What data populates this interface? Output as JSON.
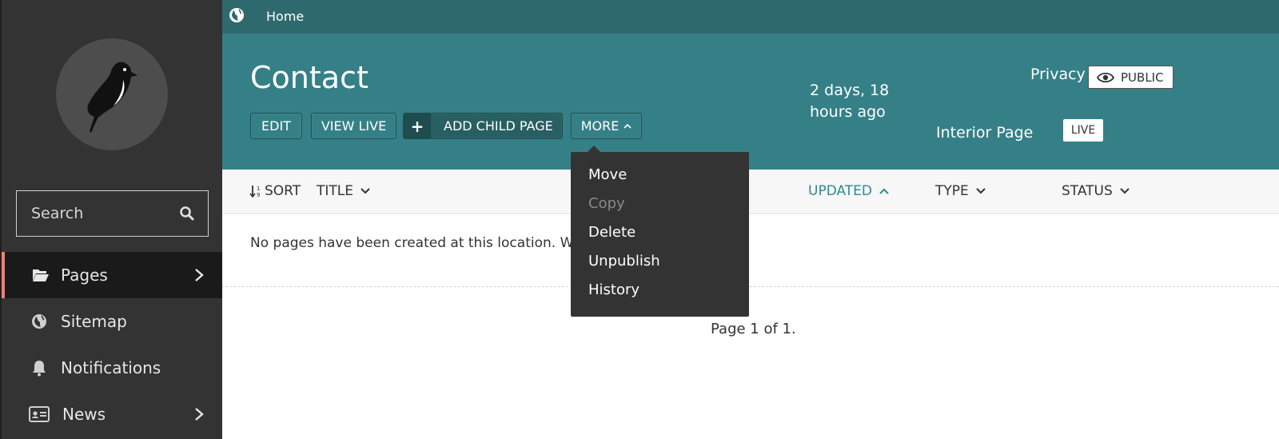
{
  "sidebar": {
    "search_label": "Search",
    "items": [
      {
        "label": "Pages",
        "icon": "folder-open-icon",
        "active": true,
        "has_submenu": true
      },
      {
        "label": "Sitemap",
        "icon": "globe-icon",
        "active": false,
        "has_submenu": false
      },
      {
        "label": "Notifications",
        "icon": "bell-icon",
        "active": false,
        "has_submenu": false
      },
      {
        "label": "News",
        "icon": "id-card-icon",
        "active": false,
        "has_submenu": true
      }
    ]
  },
  "breadcrumb": {
    "items": [
      "Home"
    ]
  },
  "header": {
    "title": "Contact",
    "buttons": {
      "edit": "EDIT",
      "view_live": "VIEW LIVE",
      "add_child": "ADD CHILD PAGE",
      "more": "MORE"
    },
    "updated": "2 days, 18 hours ago",
    "type": "Interior Page",
    "status": "LIVE",
    "privacy_label": "Privacy",
    "privacy_value": "PUBLIC"
  },
  "dropdown": {
    "items": [
      {
        "label": "Move",
        "disabled": false
      },
      {
        "label": "Copy",
        "disabled": true
      },
      {
        "label": "Delete",
        "disabled": false
      },
      {
        "label": "Unpublish",
        "disabled": false
      },
      {
        "label": "History",
        "disabled": false
      }
    ]
  },
  "columns": {
    "sort": "SORT",
    "title": "TITLE",
    "updated": "UPDATED",
    "type": "TYPE",
    "status": "STATUS"
  },
  "listing": {
    "empty_message": "No pages have been created at this location. Wh",
    "pagination": "Page 1 of 1."
  },
  "colors": {
    "sidebar_bg": "#333333",
    "topbar_bg": "#2e6a6d",
    "header_bg": "#358087",
    "active_accent": "#f37e77",
    "sort_active": "#2a8c92"
  }
}
